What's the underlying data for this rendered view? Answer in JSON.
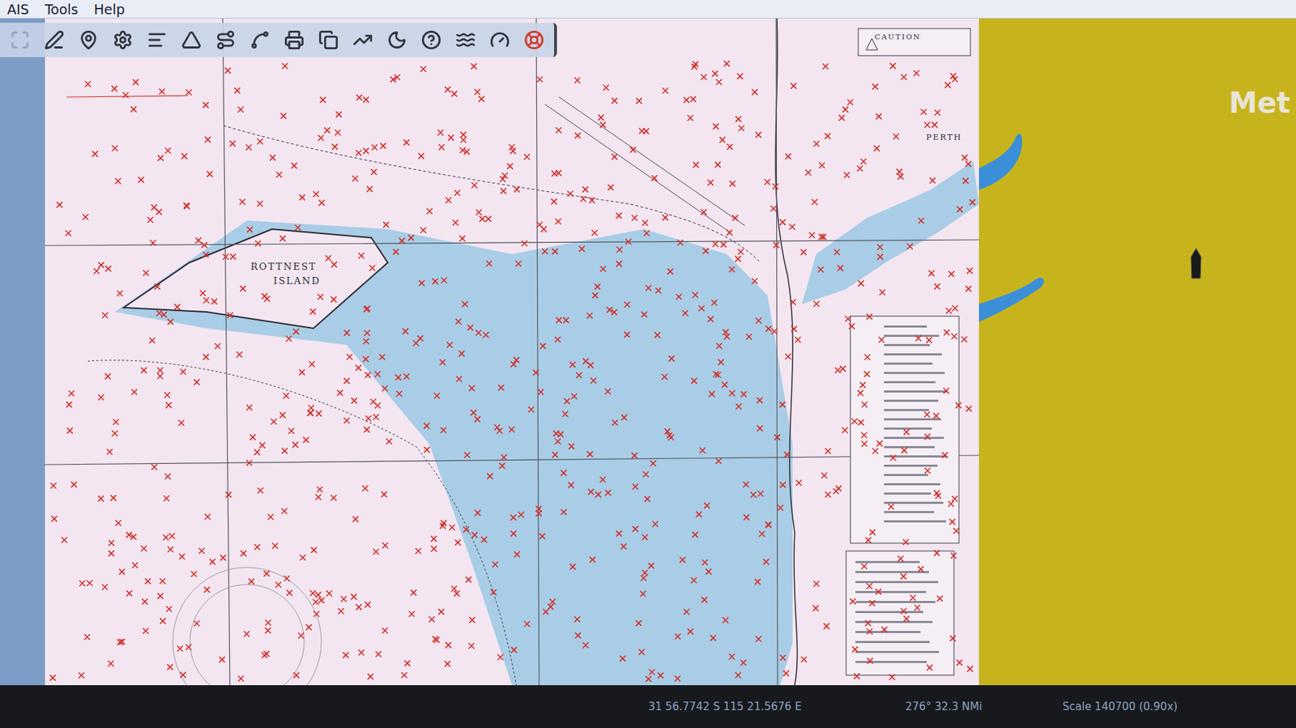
{
  "menu": [
    {
      "label": "AIS"
    },
    {
      "label": "Tools"
    },
    {
      "label": "Help"
    }
  ],
  "chart": {
    "labels": [
      {
        "text": "ROTTNEST"
      },
      {
        "text": "ISLAND"
      },
      {
        "text": "PERTH"
      },
      {
        "text": "CAUTION"
      }
    ]
  },
  "overlay": {
    "label": "Met"
  },
  "status_bar": {
    "position": "31 56.7742 S  115 21.5676 E",
    "bearing": "276° 32.3 NMi",
    "scale": "Scale 140700 (0.90x)"
  }
}
